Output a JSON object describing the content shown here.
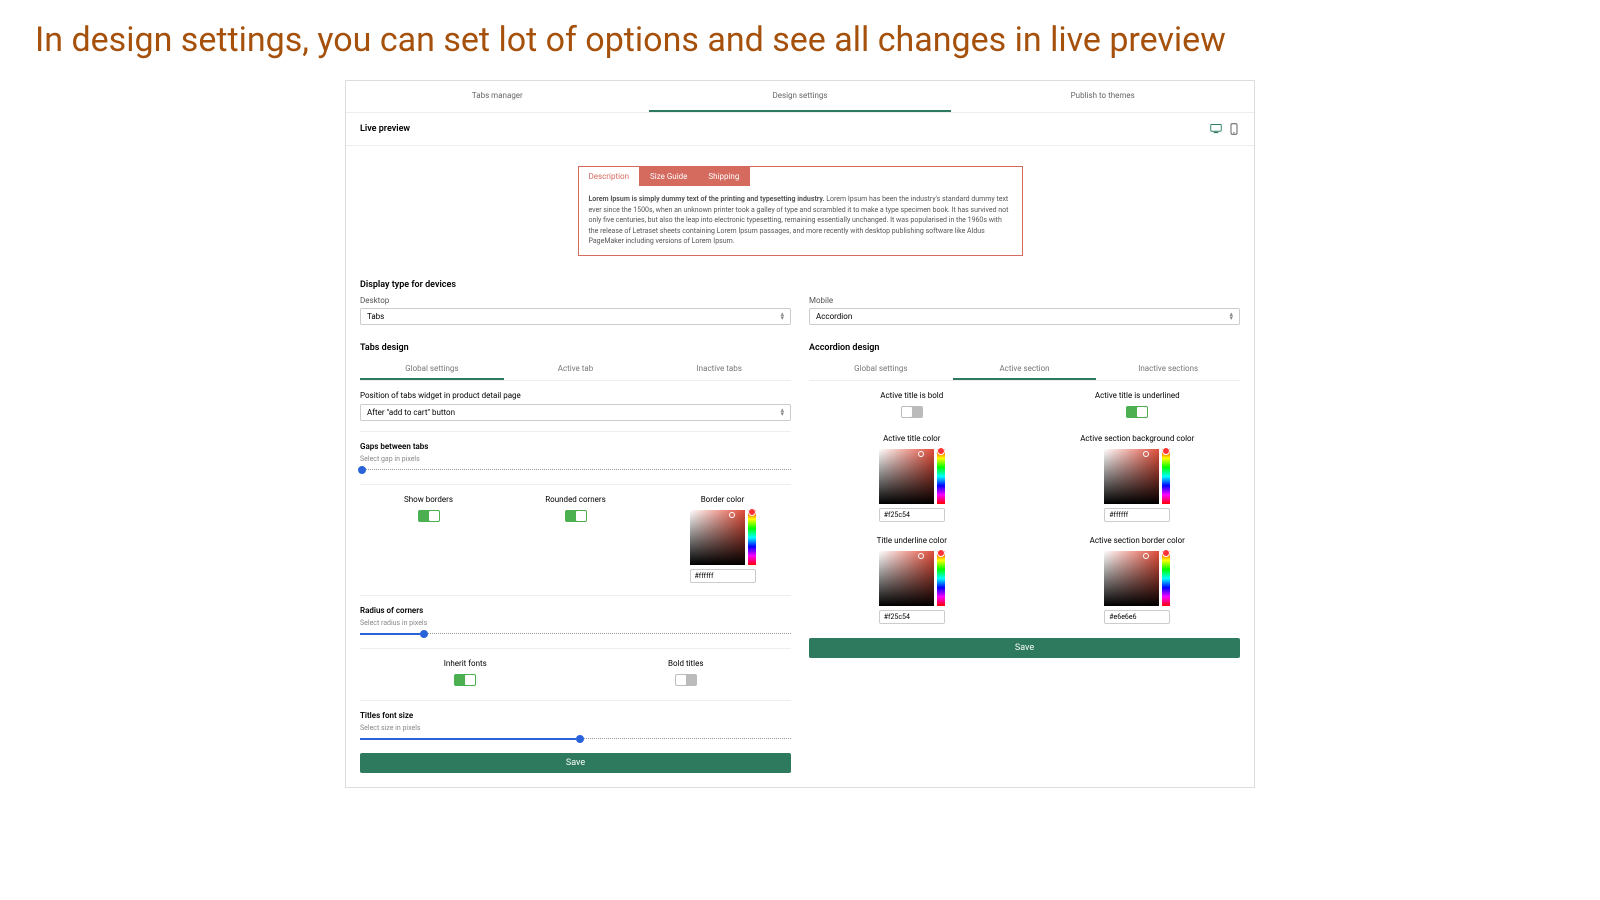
{
  "headline": "In design settings, you can set lot of options and see all changes in live preview",
  "topTabs": {
    "a": "Tabs manager",
    "b": "Design settings",
    "c": "Publish to themes"
  },
  "livePreview": {
    "title": "Live preview",
    "tabs": {
      "a": "Description",
      "b": "Size Guide",
      "c": "Shipping"
    },
    "bold": "Lorem Ipsum is simply dummy text of the printing and typesetting industry.",
    "rest": " Lorem Ipsum has been the industry's standard dummy text ever since the 1500s, when an unknown printer took a galley of type and scrambled it to make a type specimen book. It has survived not only five centuries, but also the leap into electronic typesetting, remaining essentially unchanged. It was popularised in the 1960s with the release of Letraset sheets containing Lorem Ipsum passages, and more recently with desktop publishing software like Aldus PageMaker including versions of Lorem Ipsum."
  },
  "displayType": {
    "title": "Display type for devices",
    "desktop": {
      "lbl": "Desktop",
      "val": "Tabs"
    },
    "mobile": {
      "lbl": "Mobile",
      "val": "Accordion"
    }
  },
  "left": {
    "title": "Tabs design",
    "subtabs": {
      "a": "Global settings",
      "b": "Active tab",
      "c": "Inactive tabs"
    },
    "position": {
      "lbl": "Position of tabs widget in product detail page",
      "val": "After \"add to cart\" button"
    },
    "gaps": {
      "title": "Gaps between tabs",
      "lbl": "Select gap in pixels"
    },
    "show_borders": "Show borders",
    "rounded_corners": "Rounded corners",
    "border_color": {
      "lbl": "Border color",
      "val": "#ffffff"
    },
    "radius": {
      "title": "Radius of corners",
      "lbl": "Select radius in pixels"
    },
    "inherit_fonts": "Inherit fonts",
    "bold_titles": "Bold titles",
    "font_size": {
      "title": "Titles font size",
      "lbl": "Select size in pixels"
    },
    "save": "Save"
  },
  "right": {
    "title": "Accordion design",
    "subtabs": {
      "a": "Global settings",
      "b": "Active section",
      "c": "Inactive sections"
    },
    "active_bold": "Active title is bold",
    "active_underlined": "Active title is underlined",
    "active_title_color": {
      "lbl": "Active title color",
      "val": "#f25c54"
    },
    "active_bg": {
      "lbl": "Active section background color",
      "val": "#ffffff"
    },
    "underline_color": {
      "lbl": "Title underline color",
      "val": "#f25c54"
    },
    "border_color": {
      "lbl": "Active section border color",
      "val": "#e6e6e6"
    },
    "save": "Save"
  }
}
